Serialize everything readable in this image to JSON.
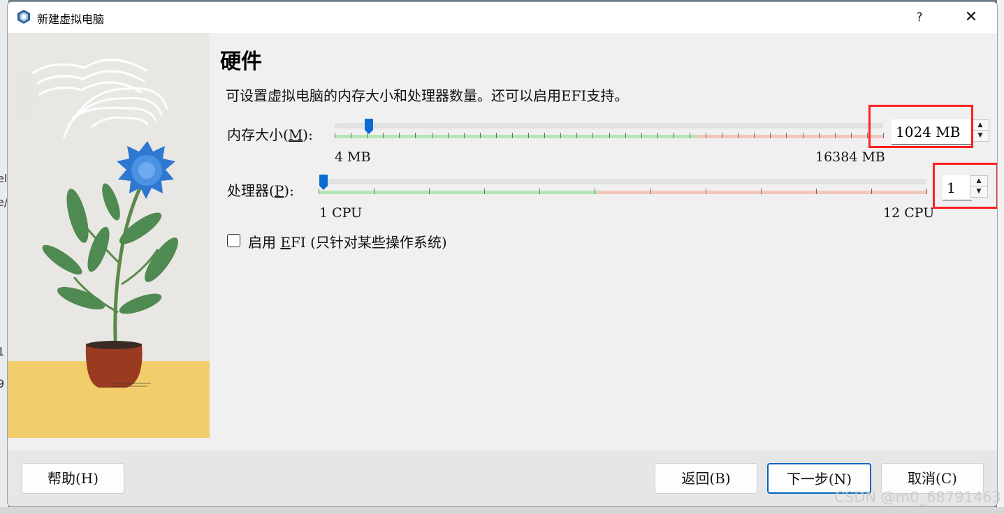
{
  "window": {
    "title": "新建虚拟电脑",
    "help_label": "?",
    "close_label": "✕"
  },
  "page": {
    "heading": "硬件",
    "description": "可设置虚拟电脑的内存大小和处理器数量。还可以启用EFI支持。"
  },
  "memory": {
    "label_prefix": "内存大小(",
    "label_key": "M",
    "label_suffix": "):",
    "min_label": "4 MB",
    "max_label": "16384 MB",
    "value": "1024 MB",
    "slider_value": 1024,
    "slider_min": 4,
    "slider_max": 16384
  },
  "processor": {
    "label_prefix": "处理器(",
    "label_key": "P",
    "label_suffix": "):",
    "min_label": "1 CPU",
    "max_label": "12 CPU",
    "value": "1",
    "slider_value": 1,
    "slider_min": 1,
    "slider_max": 12
  },
  "efi": {
    "label_prefix": "启用 ",
    "label_key": "E",
    "label_suffix": "FI (只针对某些操作系统)",
    "checked": false
  },
  "buttons": {
    "help": "帮助(H)",
    "back": "返回(B)",
    "next": "下一步(N)",
    "cancel": "取消(C)"
  },
  "colors": {
    "accent": "#0067c0",
    "slider_green": "#b3e8b3",
    "slider_red": "#f4c6bb",
    "highlight": "#ff2020"
  },
  "watermark": "CSDN @m0_68791463",
  "background_text": [
    "el",
    "e/",
    "1",
    "9"
  ]
}
